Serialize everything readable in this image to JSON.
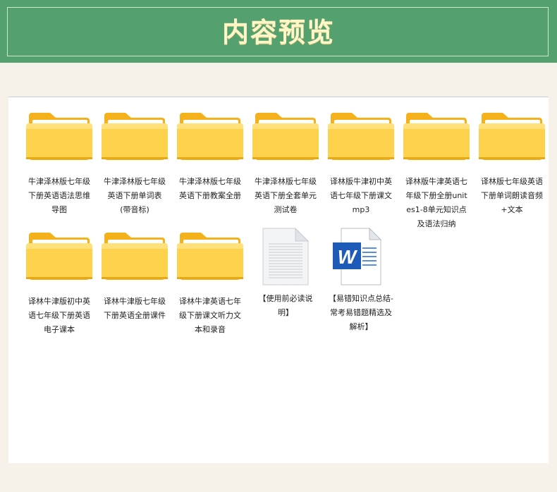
{
  "header": {
    "title": "内容预览"
  },
  "items": [
    {
      "label": "牛津泽林版七年级下册英语语法思维导图",
      "type": "folder",
      "icon": "folder-icon"
    },
    {
      "label": "牛津泽林版七年级英语下册单词表(带音标)",
      "type": "folder",
      "icon": "folder-icon"
    },
    {
      "label": "牛津泽林版七年级英语下册教案全册",
      "type": "folder",
      "icon": "folder-icon"
    },
    {
      "label": "牛津泽林版七年级英语下册全套单元测试卷",
      "type": "folder",
      "icon": "folder-icon"
    },
    {
      "label": "译林版牛津初中英语七年级下册课文mp3",
      "type": "folder",
      "icon": "folder-icon"
    },
    {
      "label": "译林版牛津英语七年级下册全册unites1-8单元知识点及语法归纳",
      "type": "folder",
      "icon": "folder-icon"
    },
    {
      "label": "译林版七年级英语下册单词朗读音频+文本",
      "type": "folder",
      "icon": "folder-icon"
    },
    {
      "label": "译林牛津版初中英语七年级下册英语电子课本",
      "type": "folder",
      "icon": "folder-icon"
    },
    {
      "label": "译林牛津版七年级下册英语全册课件",
      "type": "folder",
      "icon": "folder-icon"
    },
    {
      "label": "译林牛津英语七年级下册课文听力文本和录音",
      "type": "folder",
      "icon": "folder-icon"
    },
    {
      "label": "【使用前必读说明】",
      "type": "text",
      "icon": "text-file-icon"
    },
    {
      "label": "【易错知识点总结-常考易错题精选及解析】",
      "type": "word",
      "icon": "word-document-icon"
    }
  ],
  "colors": {
    "header_bg": "#55a06f",
    "title": "#fff6c8",
    "folder_front": "#ffd24d",
    "folder_back": "#f6b81f",
    "word_blue": "#1e5bb8"
  }
}
